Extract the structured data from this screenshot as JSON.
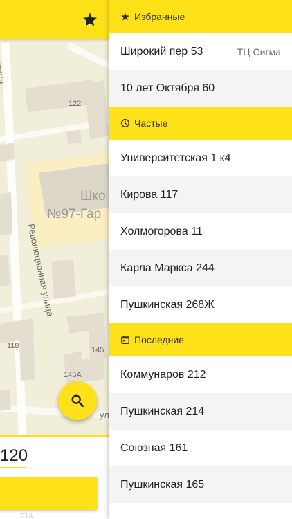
{
  "map": {
    "streets": [
      "Революционная улица",
      "Революционная улица"
    ],
    "street_partial": "ная улица",
    "school_line1": "Шко",
    "school_line2": "№97-Гар",
    "building_numbers": [
      "122",
      "118",
      "145",
      "145А"
    ],
    "partial_text": "ул",
    "search_icon": "search-icon",
    "favorite_icon": "star-icon"
  },
  "sheet": {
    "house_value": "120",
    "faint": "21А"
  },
  "favorites": {
    "header": "Избранные",
    "icon": "star-icon",
    "items": [
      {
        "address": "Широкий пер 53",
        "tag": "ТЦ Сигма"
      },
      {
        "address": "10 лет Октября 60",
        "tag": ""
      }
    ]
  },
  "frequent": {
    "header": "Частые",
    "icon": "clock-icon",
    "items": [
      "Университетская 1 к4",
      "Кирова 117",
      "Холмогорова 11",
      "Карла Маркса 244",
      "Пушкинская 268Ж"
    ]
  },
  "recent": {
    "header": "Последние",
    "icon": "calendar-icon",
    "items": [
      "Коммунаров 212",
      "Пушкинская 214",
      "Союзная 161",
      "Пушкинская 165"
    ]
  },
  "colors": {
    "accent": "#ffe11a",
    "row_alt": "#f4f4f4",
    "map_bg": "#f1efd9"
  }
}
